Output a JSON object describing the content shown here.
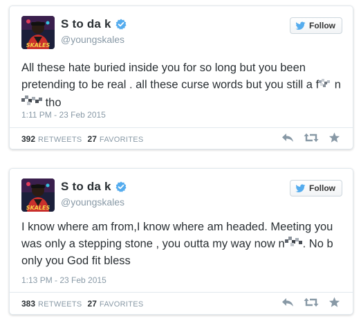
{
  "tweets": [
    {
      "display_name": "S to da k",
      "handle": "@youngskales",
      "follow_label": "Follow",
      "text_part1": "All these hate buried inside you for so long but you been pretending to be real . all these curse words but you still a f",
      "text_part2": " n",
      "text_part3": " tho",
      "timestamp": "1:11 PM - 23 Feb 2015",
      "retweets_count": "392",
      "retweets_label": "RETWEETS",
      "favorites_count": "27",
      "favorites_label": "FAVORITES"
    },
    {
      "display_name": "S to da k",
      "handle": "@youngskales",
      "follow_label": "Follow",
      "text_part1": "I know where am from,I know where am headed. Meeting you was only a stepping stone , you outta my way now n",
      "text_part2": ". No b only you God fit bless",
      "timestamp": "1:13 PM - 23 Feb 2015",
      "retweets_count": "383",
      "retweets_label": "RETWEETS",
      "favorites_count": "27",
      "favorites_label": "FAVORITES"
    }
  ],
  "avatar_text": "SKALES",
  "icons": {
    "verified": "verified-badge-icon",
    "follow": "twitter-bird-icon",
    "reply": "reply-icon",
    "retweet": "retweet-icon",
    "favorite": "star-icon"
  },
  "colors": {
    "verified_blue": "#55acee",
    "text": "#292f33",
    "muted": "#8899a6",
    "action_gray": "#8899a6",
    "follow_bird": "#55acee"
  }
}
